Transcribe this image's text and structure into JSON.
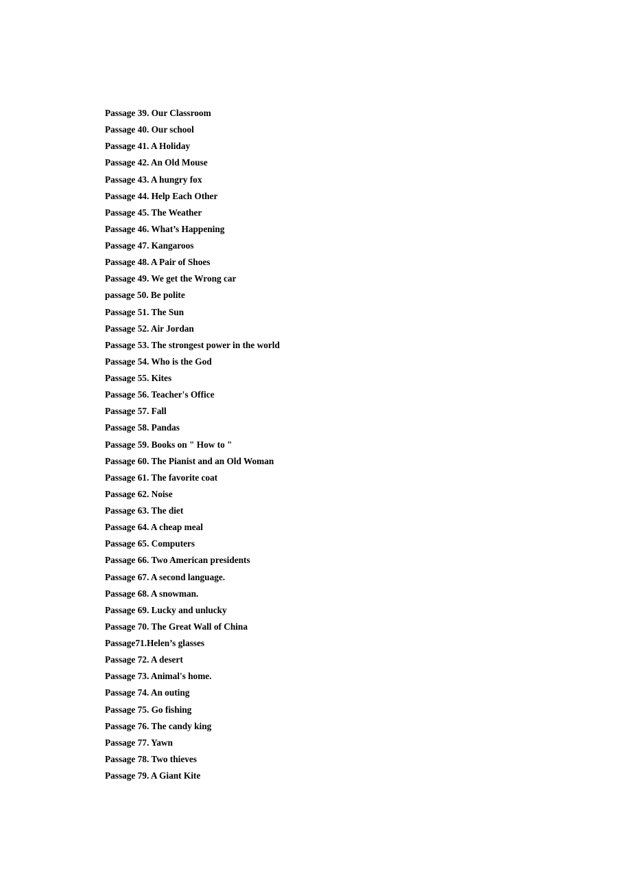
{
  "passages": [
    "Passage 39. Our Classroom",
    "Passage 40. Our school",
    "Passage 41. A Holiday",
    "Passage 42. An Old Mouse",
    "Passage 43. A hungry fox",
    "Passage 44. Help Each Other",
    "Passage 45. The Weather",
    "Passage 46. What’s Happening",
    "Passage 47. Kangaroos",
    "Passage 48. A Pair of Shoes",
    "Passage 49. We get the Wrong car",
    "passage 50. Be polite",
    "Passage 51. The Sun",
    "Passage 52. Air Jordan",
    "Passage 53. The strongest power in the world",
    "Passage 54. Who is the God",
    "Passage 55. Kites",
    "Passage 56. Teacher's Office",
    "Passage 57. Fall",
    "Passage 58. Pandas",
    "Passage 59. Books on \" How to \"",
    "Passage 60. The Pianist and an Old Woman",
    "Passage 61. The favorite coat",
    "Passage 62. Noise",
    "Passage 63. The diet",
    "Passage 64. A cheap meal",
    "Passage 65. Computers",
    "Passage 66. Two American presidents",
    "Passage 67. A second language.",
    "Passage 68. A snowman.",
    "Passage 69. Lucky and unlucky",
    "Passage 70. The Great Wall of China",
    "Passage71.Helen’s glasses",
    "Passage 72. A desert",
    "Passage 73. Animal's home.",
    "Passage 74. An outing",
    "Passage 75. Go fishing",
    "Passage 76. The candy king",
    "Passage 77. Yawn",
    "Passage 78. Two thieves",
    "Passage 79. A Giant Kite"
  ]
}
